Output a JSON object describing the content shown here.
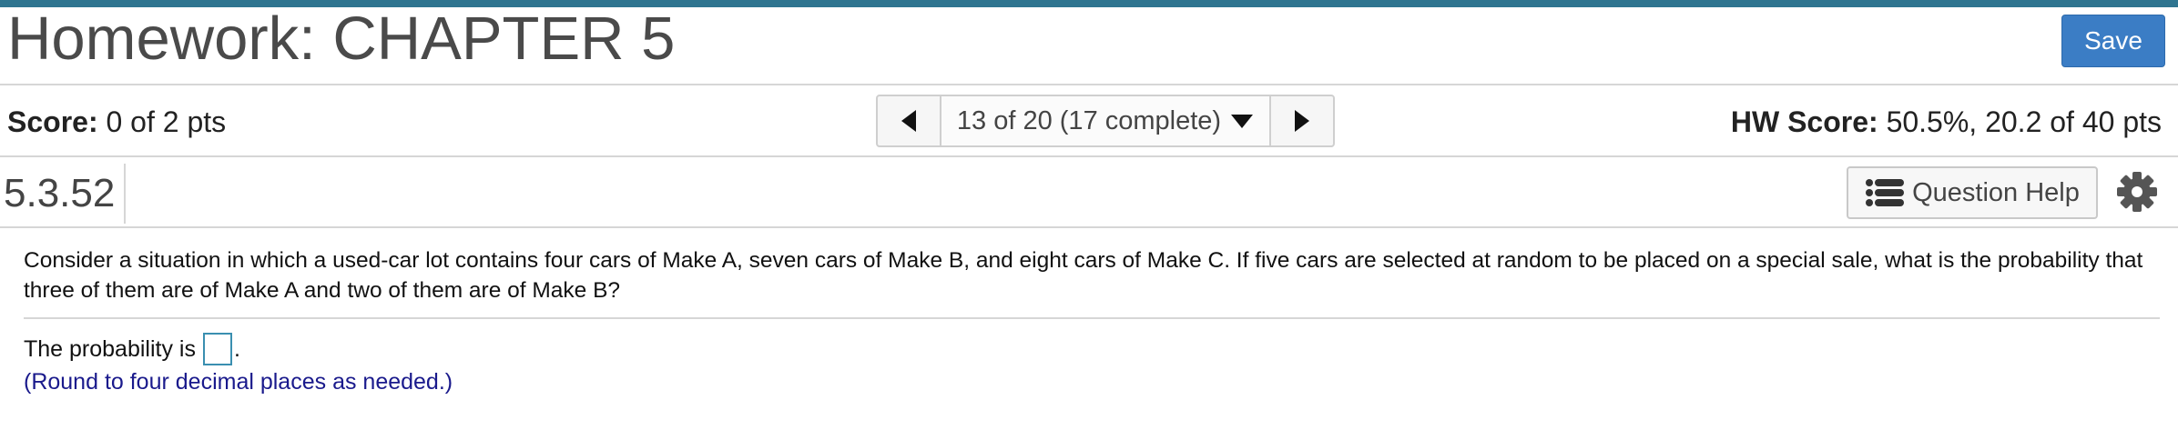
{
  "header": {
    "title": "Homework: CHAPTER 5",
    "save_label": "Save"
  },
  "score": {
    "label": "Score:",
    "value": "0 of 2 pts"
  },
  "nav": {
    "position": "13 of 20 (17 complete)"
  },
  "hw_score": {
    "label": "HW Score:",
    "value": "50.5%, 20.2 of 40 pts"
  },
  "question": {
    "number": "5.3.52",
    "help_label": "Question Help",
    "text": "Consider a situation in which a used-car lot contains four cars of Make A, seven cars of Make B, and eight cars of Make C. If five cars are selected at random to be placed on a special sale, what is the probability that three of them are of Make A and two of them are of Make B?",
    "answer_prefix": "The probability is",
    "answer_suffix": ".",
    "answer_value": "",
    "hint": "(Round to four decimal places as needed.)"
  },
  "colors": {
    "accent": "#2f7590",
    "save": "#3b7dc5",
    "hint": "#1a1a8c"
  },
  "icons": [
    "prev-arrow-icon",
    "dropdown-caret-icon",
    "next-arrow-icon",
    "list-icon",
    "gear-icon"
  ]
}
